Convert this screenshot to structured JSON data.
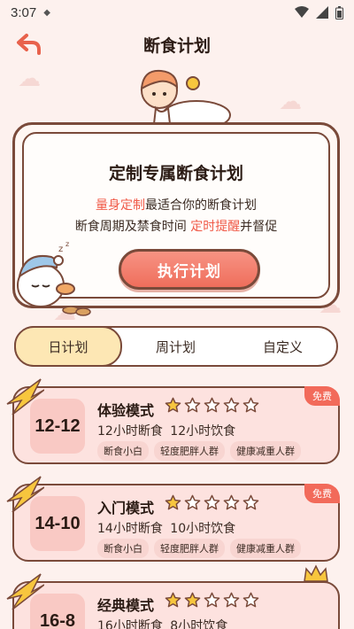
{
  "status_bar": {
    "time": "3:07"
  },
  "header": {
    "title": "断食计划"
  },
  "card": {
    "title": "定制专属断食计划",
    "line1": {
      "highlight": "量身定制",
      "rest": "最适合你的断食计划"
    },
    "line2": {
      "lead": "断食周期及禁食时间 ",
      "highlight": "定时提醒",
      "rest": "并督促"
    },
    "button_label": "执行计划"
  },
  "tabs": [
    {
      "label": "日计划"
    },
    {
      "label": "周计划"
    },
    {
      "label": "自定义"
    }
  ],
  "plans": [
    {
      "ratio": "12-12",
      "name": "体验模式",
      "stars": 1,
      "fast": "12小时断食",
      "eat": "12小时饮食",
      "tags": [
        "断食小白",
        "轻度肥胖人群",
        "健康减重人群"
      ],
      "badge": "免费"
    },
    {
      "ratio": "14-10",
      "name": "入门模式",
      "stars": 1,
      "fast": "14小时断食",
      "eat": "10小时饮食",
      "tags": [
        "断食小白",
        "轻度肥胖人群",
        "健康减重人群"
      ],
      "badge": "免费"
    },
    {
      "ratio": "16-8",
      "name": "经典模式",
      "stars": 2,
      "fast": "16小时断食",
      "eat": "8小时饮食",
      "tags": [],
      "badge": ""
    }
  ],
  "colors": {
    "accent": "#f05a48",
    "border": "#7a4a3a",
    "star": "#f7c63e",
    "card_bg": "#fde2df"
  }
}
